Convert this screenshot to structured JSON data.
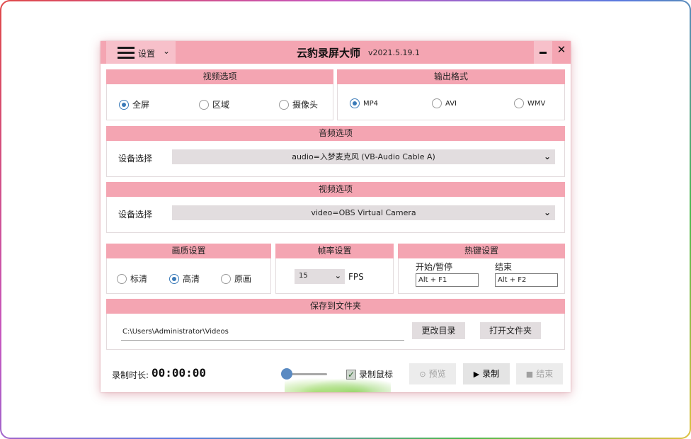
{
  "titlebar": {
    "menu_label": "设置",
    "app_name": "云豹录屏大师",
    "version": "v2021.5.19.1",
    "minimize_symbol": "",
    "close_symbol": "✕"
  },
  "video_options": {
    "title": "视频选项",
    "options": [
      {
        "label": "全屏",
        "checked": true
      },
      {
        "label": "区域",
        "checked": false
      },
      {
        "label": "摄像头",
        "checked": false
      }
    ]
  },
  "output_format": {
    "title": "输出格式",
    "options": [
      {
        "label": "MP4",
        "checked": true
      },
      {
        "label": "AVI",
        "checked": false
      },
      {
        "label": "WMV",
        "checked": false
      }
    ]
  },
  "audio_options": {
    "title": "音频选项",
    "device_label": "设备选择",
    "device_value": "audio=入梦麦克风 (VB-Audio Cable A)"
  },
  "camera_options": {
    "title": "视频选项",
    "device_label": "设备选择",
    "device_value": "video=OBS Virtual Camera"
  },
  "quality": {
    "title": "画质设置",
    "options": [
      {
        "label": "标清",
        "checked": false
      },
      {
        "label": "高清",
        "checked": true
      },
      {
        "label": "原画",
        "checked": false
      }
    ]
  },
  "framerate": {
    "title": "帧率设置",
    "value": "15",
    "unit": "FPS"
  },
  "hotkeys": {
    "title": "热键设置",
    "start_label": "开始/暂停",
    "start_value": "Alt + F1",
    "end_label": "结束",
    "end_value": "Alt + F2"
  },
  "save": {
    "title": "保存到文件夹",
    "path": "C:\\Users\\Administrator\\Videos",
    "change_dir_label": "更改目录",
    "open_folder_label": "打开文件夹"
  },
  "bottom": {
    "duration_label": "录制时长:",
    "duration_value": "00:00:00",
    "record_mouse_label": "录制鼠标",
    "record_mouse_checked": true,
    "preview_label": "预览",
    "record_label": "录制",
    "stop_label": "结束"
  },
  "colors": {
    "accent_pink": "#f4a5b2",
    "radio_blue": "#3a7ab8"
  }
}
